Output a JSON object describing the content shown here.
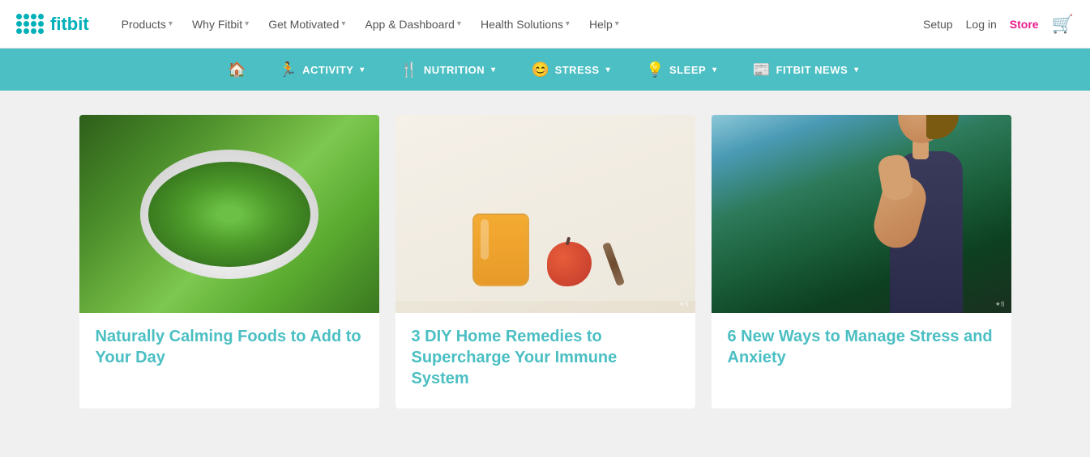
{
  "logo": {
    "text": "fitbit"
  },
  "topNav": {
    "links": [
      {
        "label": "Products",
        "hasDropdown": true
      },
      {
        "label": "Why Fitbit",
        "hasDropdown": true
      },
      {
        "label": "Get Motivated",
        "hasDropdown": true
      },
      {
        "label": "App & Dashboard",
        "hasDropdown": true
      },
      {
        "label": "Health Solutions",
        "hasDropdown": true
      },
      {
        "label": "Help",
        "hasDropdown": true
      }
    ],
    "rightLinks": [
      {
        "label": "Setup"
      },
      {
        "label": "Log in"
      },
      {
        "label": "Store",
        "accent": true
      }
    ]
  },
  "secondaryNav": {
    "items": [
      {
        "label": "",
        "icon": "🏠",
        "isHome": true
      },
      {
        "label": "ACTIVITY",
        "icon": "🏃",
        "hasDropdown": true
      },
      {
        "label": "NUTRITION",
        "icon": "🍴",
        "hasDropdown": true
      },
      {
        "label": "STRESS",
        "icon": "😊",
        "hasDropdown": true
      },
      {
        "label": "SLEEP",
        "icon": "💡",
        "hasDropdown": true
      },
      {
        "label": "FITBIT NEWS",
        "icon": "📰",
        "hasDropdown": true
      }
    ]
  },
  "cards": [
    {
      "title": "Naturally Calming Foods to Add to Your Day",
      "image_type": "salad"
    },
    {
      "title": "3 DIY Home Remedies to Supercharge Your Immune System",
      "image_type": "smoothie"
    },
    {
      "title": "6 New Ways to Manage Stress and Anxiety",
      "image_type": "woman"
    }
  ]
}
